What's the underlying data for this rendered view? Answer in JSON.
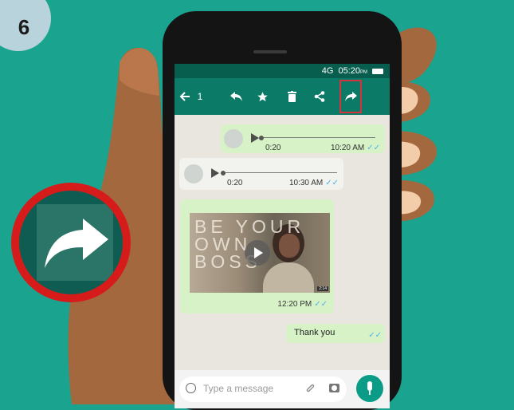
{
  "step": {
    "number": "6"
  },
  "status_bar": {
    "network": "4G",
    "time": "05:20",
    "period": "PM"
  },
  "toolbar": {
    "back_icon": "arrow-left-icon",
    "selected_count": "1",
    "actions": [
      "reply-icon",
      "star-icon",
      "delete-icon",
      "share-icon",
      "forward-icon"
    ],
    "highlighted_action": "forward-icon",
    "highlight_color": "#d8323f"
  },
  "messages": [
    {
      "type": "voice",
      "direction": "outgoing",
      "duration": "0:20",
      "time": "10:20 AM",
      "ticks": "✓✓"
    },
    {
      "type": "voice",
      "direction": "incoming",
      "duration": "0:20",
      "time": "10:30 AM",
      "ticks": "✓✓"
    },
    {
      "type": "video",
      "direction": "outgoing",
      "overlay_text": "BE YOUR\nOWN\nBOSS",
      "length": "2:14",
      "time": "12:20 PM",
      "ticks": "✓✓"
    },
    {
      "type": "text",
      "direction": "outgoing",
      "text": "Thank you",
      "ticks": "✓✓"
    }
  ],
  "input": {
    "placeholder": "Type a message",
    "emoji_icon": "emoji-icon",
    "attach_icon": "paperclip-icon",
    "camera_icon": "camera-icon",
    "mic_icon": "microphone-icon"
  },
  "callout": {
    "icon": "forward-icon",
    "ring_color": "#d61b1b"
  },
  "colors": {
    "background": "#1aa38f",
    "header": "#0b7a66",
    "status": "#075e4f",
    "outgoing_bubble": "#d7f2c6",
    "incoming_bubble": "#f2f2ee",
    "tick": "#4fb3e6"
  }
}
